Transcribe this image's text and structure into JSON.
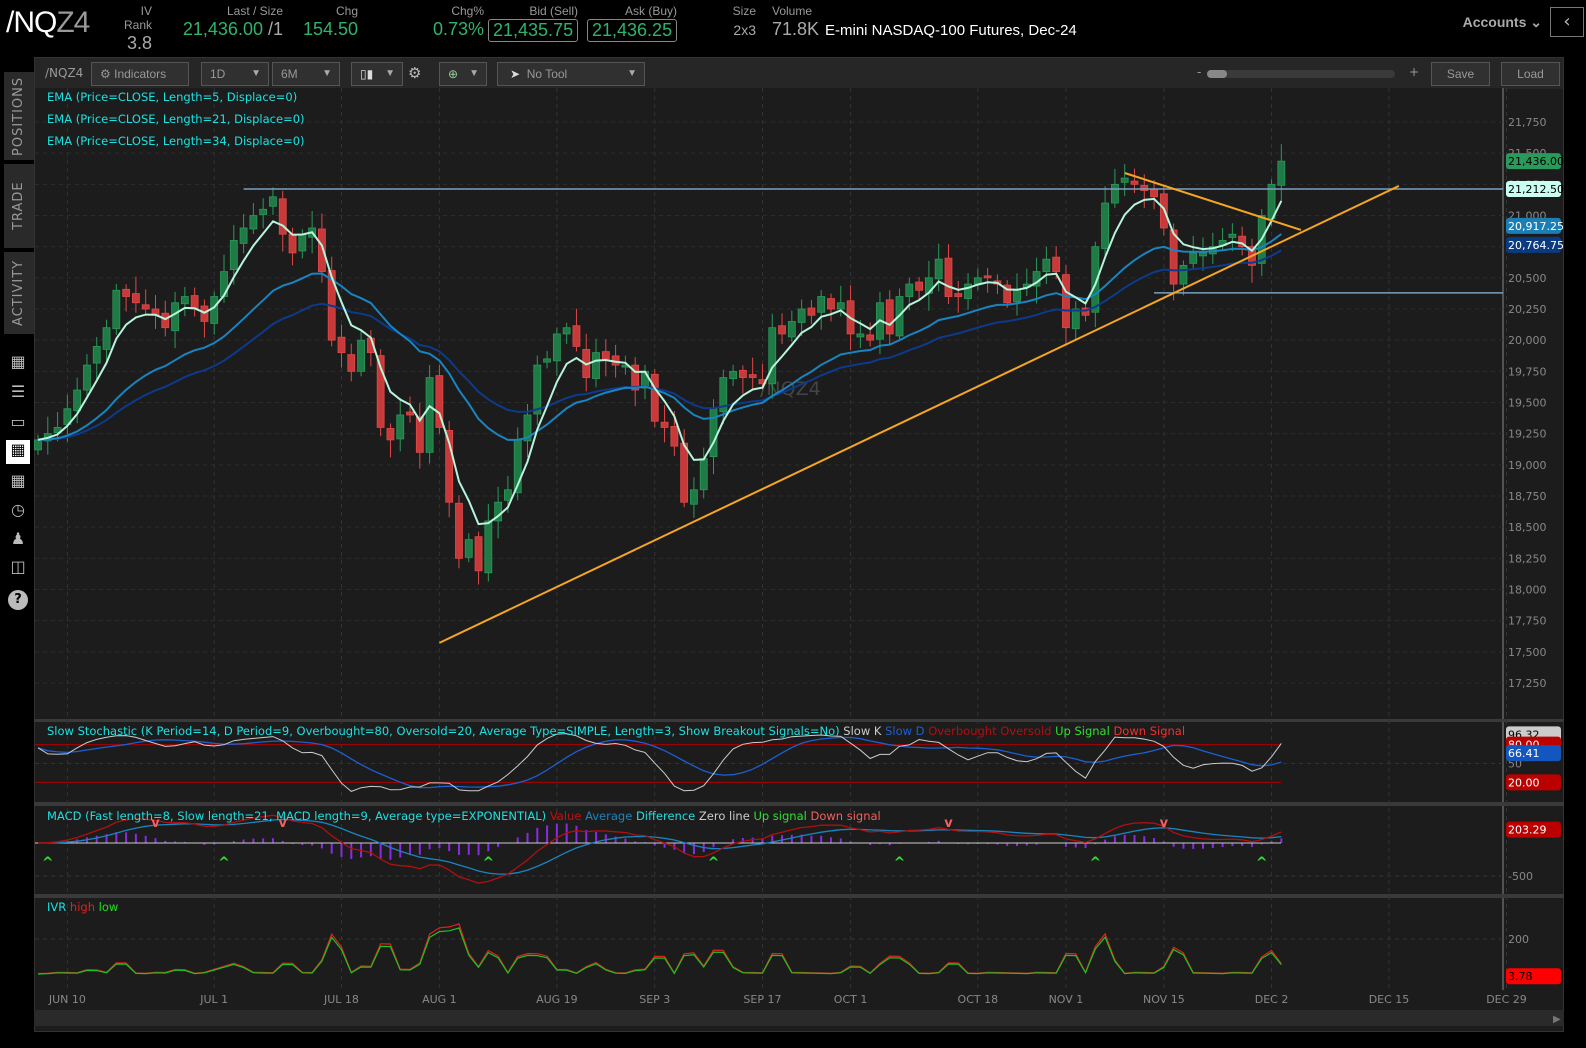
{
  "header": {
    "symbol_main": "/NQ",
    "symbol_suffix": "Z4",
    "iv_rank_label": "IV Rank",
    "iv_rank": "3.8",
    "last_label": "Last / Size",
    "last": "21,436.00",
    "last_size": "/1",
    "chg_label": "Chg",
    "chg": "154.50",
    "chgpct_label": "Chg%",
    "chgpct": "0.73%",
    "bid_label": "Bid (Sell)",
    "bid": "21,435.75",
    "ask_label": "Ask (Buy)",
    "ask": "21,436.25",
    "size_label": "Size",
    "size": "2x3",
    "volume_label": "Volume",
    "volume": "71.8K",
    "description": "E-mini NASDAQ-100 Futures, Dec-24",
    "accounts": "Accounts"
  },
  "sidebar": {
    "tabs": [
      "POSITIONS",
      "TRADE",
      "ACTIVITY"
    ]
  },
  "toolbar": {
    "symbol": "/NQZ4",
    "indicators": "Indicators",
    "aggregation": "1D",
    "timeframe": "6M",
    "tool": "No Tool",
    "zoom_minus": "-",
    "zoom_plus": "+",
    "save": "Save",
    "load": "Load"
  },
  "legends": {
    "ema1": "EMA (Price=CLOSE, Length=5, Displace=0)",
    "ema2": "EMA (Price=CLOSE, Length=21, Displace=0)",
    "ema3": "EMA (Price=CLOSE, Length=34, Displace=0)",
    "stoch": "Slow Stochastic (K Period=14, D Period=9, Overbought=80, Oversold=20, Average Type=SIMPLE, Length=3, Show Breakout Signals=No)",
    "stoch_items": [
      "Slow K",
      "Slow D",
      "Overbought",
      "Oversold",
      "Up Signal",
      "Down Signal"
    ],
    "macd": "MACD (Fast length=8, Slow length=21, MACD length=9, Average type=EXPONENTIAL)",
    "macd_items": [
      "Value",
      "Average",
      "Difference",
      "Zero line",
      "Up signal",
      "Down signal"
    ],
    "ivr": "IVR",
    "ivr_items": [
      "high",
      "low"
    ]
  },
  "watermark": "/NQZ4",
  "colors": {
    "up": "#1f7a45",
    "down": "#c83a3a",
    "ema5": "#b6f5dc",
    "ema21": "#1a84c0",
    "ema34": "#0d3a8a",
    "trend": "#f5a623",
    "level": "#7aa0c0"
  },
  "chart_data": {
    "type": "candlestick",
    "price_axis": {
      "min": 17250,
      "max": 21750,
      "step": 250,
      "labels": [
        "21,750",
        "21,500",
        "21,250",
        "21,000",
        "20,750",
        "20,500",
        "20,250",
        "20,000",
        "19,750",
        "19,500",
        "19,250",
        "19,000",
        "18,750",
        "18,500",
        "18,250",
        "18,000",
        "17,750",
        "17,500",
        "17,250"
      ]
    },
    "date_labels": [
      {
        "label": "JUN 10",
        "i": 3
      },
      {
        "label": "JUL 1",
        "i": 18
      },
      {
        "label": "JUL 18",
        "i": 31
      },
      {
        "label": "AUG 1",
        "i": 41
      },
      {
        "label": "AUG 19",
        "i": 53
      },
      {
        "label": "SEP 3",
        "i": 63
      },
      {
        "label": "SEP 17",
        "i": 74
      },
      {
        "label": "OCT 1",
        "i": 83
      },
      {
        "label": "OCT 18",
        "i": 96
      },
      {
        "label": "NOV 1",
        "i": 105
      },
      {
        "label": "NOV 15",
        "i": 115
      },
      {
        "label": "DEC 2",
        "i": 126
      },
      {
        "label": "DEC 15",
        "i": 138
      },
      {
        "label": "DEC 29",
        "i": 150
      }
    ],
    "closes": [
      19200,
      19250,
      19300,
      19450,
      19600,
      19800,
      19950,
      20100,
      20400,
      20350,
      20300,
      20250,
      20200,
      20100,
      20300,
      20350,
      20250,
      20150,
      20350,
      20550,
      20800,
      20900,
      21000,
      21050,
      21150,
      20850,
      20700,
      20850,
      20900,
      20550,
      20000,
      19900,
      19750,
      20000,
      19900,
      19300,
      19200,
      19400,
      19400,
      19100,
      19700,
      19300,
      18700,
      18250,
      18400,
      18150,
      18550,
      18700,
      18800,
      19200,
      19400,
      19800,
      19850,
      20050,
      20100,
      19950,
      19700,
      19900,
      19850,
      19800,
      19800,
      19600,
      19750,
      19350,
      19300,
      19150,
      18700,
      18800,
      19050,
      19450,
      19700,
      19750,
      19700,
      19700,
      19650,
      20100,
      20050,
      20150,
      20250,
      20200,
      20350,
      20250,
      20300,
      20050,
      20050,
      20000,
      20300,
      20050,
      20350,
      20450,
      20400,
      20500,
      20650,
      20350,
      20350,
      20450,
      20500,
      20500,
      20450,
      20300,
      20400,
      20450,
      20550,
      20650,
      20550,
      20100,
      20250,
      20200,
      20750,
      21100,
      21250,
      21300,
      21250,
      21200,
      21150,
      20900,
      20450,
      20600,
      20700,
      20700,
      20750,
      20800,
      20850,
      20750,
      20600,
      21000,
      21250,
      21436
    ],
    "levels": [
      {
        "price": 21212.5,
        "from": 21
      },
      {
        "price": 20379,
        "from": 114
      }
    ],
    "trendlines": [
      {
        "from": [
          41,
          17572
        ],
        "to": [
          139,
          21237
        ]
      },
      {
        "from": [
          111,
          21341
        ],
        "to": [
          129,
          20884
        ]
      }
    ],
    "badges": [
      {
        "text": "21,436.00",
        "price": 21436,
        "bg": "#2a9a5a",
        "fg": "#000"
      },
      {
        "text": "21,212.50",
        "price": 21212.5,
        "bg": "#c8fff0",
        "fg": "#000"
      },
      {
        "text": "20,917.25",
        "price": 20917.25,
        "bg": "#1b7fb5",
        "fg": "#fff"
      },
      {
        "text": "20,764.75",
        "price": 20764.75,
        "bg": "#0a3a80",
        "fg": "#fff"
      }
    ],
    "stoch_axis": {
      "labels": [
        "50"
      ],
      "badges": [
        {
          "text": "96.32",
          "v": 96.32,
          "bg": "#ccc",
          "fg": "#000"
        },
        {
          "text": "80.00",
          "v": 80,
          "bg": "#b00",
          "fg": "#fff"
        },
        {
          "text": "66.41",
          "v": 66.41,
          "bg": "#1456c0",
          "fg": "#fff"
        },
        {
          "text": "20.00",
          "v": 20,
          "bg": "#b00",
          "fg": "#fff"
        }
      ]
    },
    "macd_axis": {
      "labels": [
        "-500"
      ],
      "badges": [
        {
          "text": "203.29",
          "v": 203.29,
          "bg": "#b00",
          "fg": "#fff"
        }
      ]
    },
    "macd_signals": {
      "up": [
        1,
        19,
        46,
        69,
        88,
        108,
        125
      ],
      "down": [
        12,
        25,
        93,
        115
      ]
    },
    "ivr_axis": {
      "labels": [
        "200"
      ],
      "badges": [
        {
          "text": "3.78",
          "v": 3.78,
          "bg": "#f00",
          "fg": "#000"
        }
      ]
    }
  }
}
